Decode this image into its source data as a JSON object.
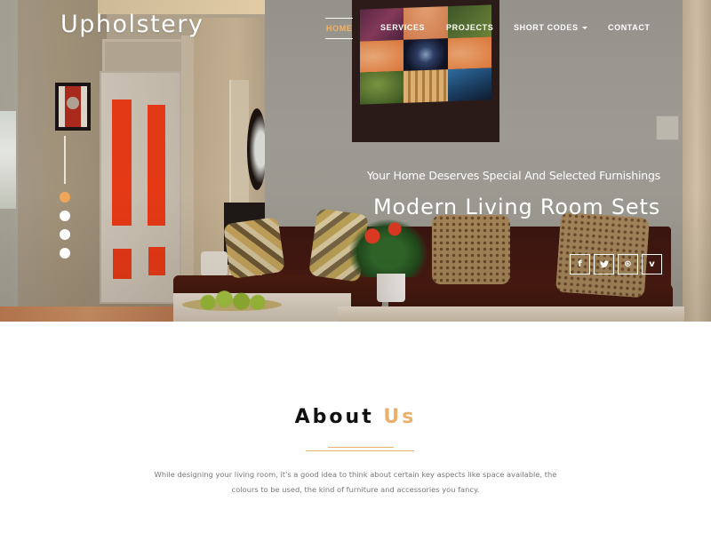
{
  "header": {
    "logo": "Upholstery",
    "nav": [
      {
        "label": "HOME",
        "active": true
      },
      {
        "label": "SERVICES",
        "active": false
      },
      {
        "label": "PROJECTS",
        "active": false
      },
      {
        "label": "SHORT CODES",
        "active": false,
        "has_dropdown": true
      },
      {
        "label": "CONTACT",
        "active": false
      }
    ]
  },
  "hero": {
    "tagline": "Your Home Deserves Special And Selected Furnishings",
    "headline": "Modern Living Room Sets",
    "slider": {
      "total_slides": 4,
      "active_slide": 1
    },
    "social": [
      {
        "name": "facebook",
        "glyph": "f"
      },
      {
        "name": "twitter",
        "glyph": "t"
      },
      {
        "name": "dribbble",
        "glyph": "⊛"
      },
      {
        "name": "vimeo",
        "glyph": "v"
      }
    ]
  },
  "about": {
    "title_main": "About",
    "title_accent": "Us",
    "text": "While designing your living room, it's a good idea to think about certain key aspects like space available, the colours to be used, the kind of furniture and accessories you fancy."
  },
  "colors": {
    "accent": "#eab06e",
    "nav_active": "#f0b36a",
    "slider_active": "#f0a65a"
  }
}
